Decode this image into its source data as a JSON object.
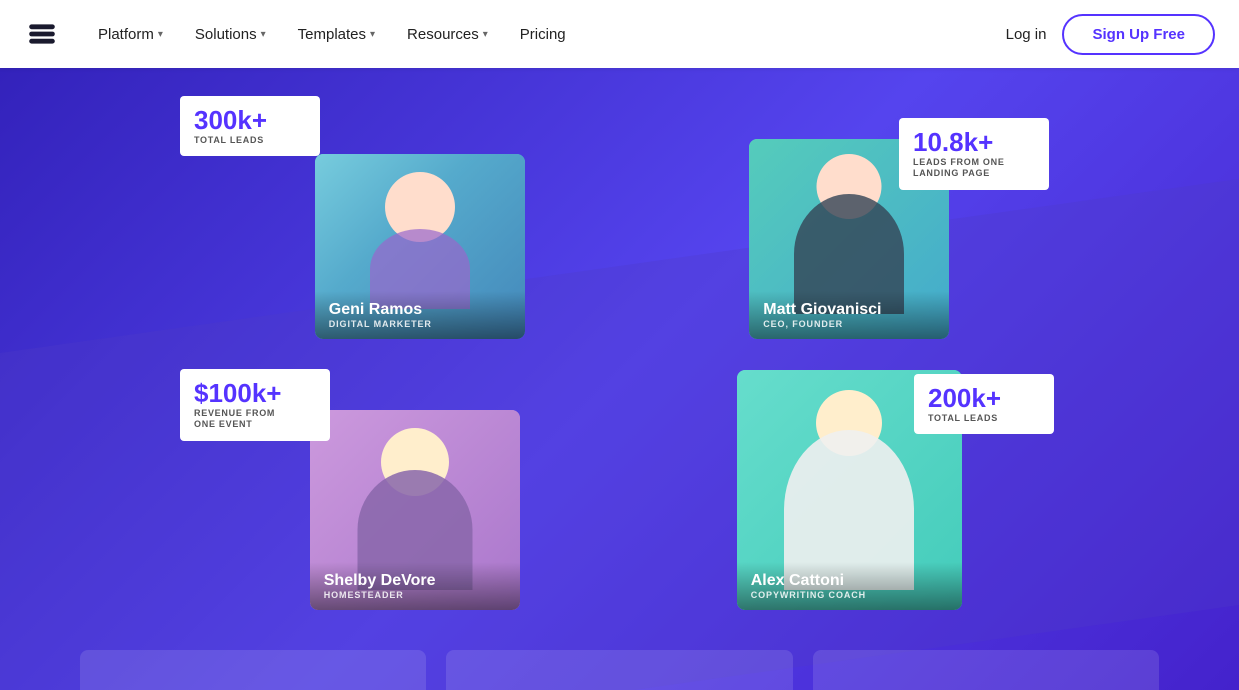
{
  "nav": {
    "logo_alt": "Brand Logo",
    "items": [
      {
        "label": "Platform",
        "has_dropdown": true
      },
      {
        "label": "Solutions",
        "has_dropdown": true
      },
      {
        "label": "Templates",
        "has_dropdown": true
      },
      {
        "label": "Resources",
        "has_dropdown": true
      },
      {
        "label": "Pricing",
        "has_dropdown": false
      }
    ],
    "login_label": "Log in",
    "signup_label": "Sign Up Free"
  },
  "cards": [
    {
      "id": "geni",
      "stat_number": "300k+",
      "stat_label": "TOTAL LEADS",
      "name": "Geni Ramos",
      "title": "DIGITAL MARKETER",
      "bg_color1": "#55ddcc",
      "bg_color2": "#4488dd"
    },
    {
      "id": "matt",
      "stat_number": "10.8k+",
      "stat_label": "LEADS FROM ONE\nLANDING PAGE",
      "name": "Matt Giovanisci",
      "title": "CEO, FOUNDER",
      "bg_color1": "#55ccbb",
      "bg_color2": "#44aacc"
    },
    {
      "id": "shelby",
      "stat_number": "$100k+",
      "stat_label": "REVENUE FROM\nONE EVENT",
      "name": "Shelby DeVore",
      "title": "HOMESTEADER",
      "bg_color1": "#ccaadd",
      "bg_color2": "#9966cc"
    },
    {
      "id": "alex",
      "stat_number": "200k+",
      "stat_label": "TOTAL LEADS",
      "name": "Alex Cattoni",
      "title": "COPYWRITING COACH",
      "bg_color1": "#55ddcc",
      "bg_color2": "#33bbaa"
    }
  ],
  "accent_color": "#5533ff"
}
